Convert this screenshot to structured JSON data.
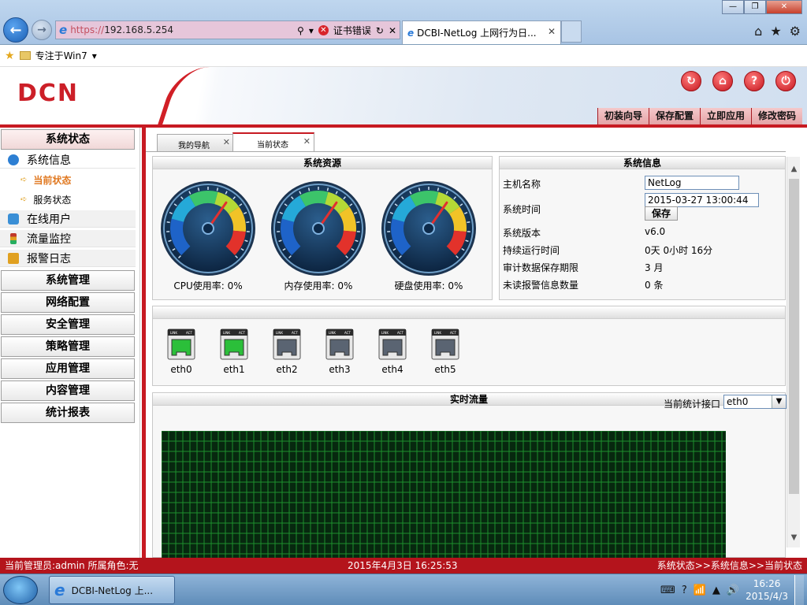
{
  "browser": {
    "address": {
      "proto": "https://",
      "host": "192.168.5.254",
      "cert_error": "证书错误"
    },
    "tab_title": "DCBI-NetLog 上网行为日...",
    "favorites": {
      "item": "专注于Win7"
    }
  },
  "app": {
    "logo": "DCN",
    "header_menu": [
      "初装向导",
      "保存配置",
      "立即应用",
      "修改密码"
    ],
    "header_icons": [
      "refresh-icon",
      "home-icon",
      "help-icon",
      "logout-icon"
    ]
  },
  "sidebar": {
    "sections": [
      "系统状态",
      "系统管理",
      "网络配置",
      "安全管理",
      "策略管理",
      "应用管理",
      "内容管理",
      "统计报表"
    ],
    "status_items": [
      {
        "label": "系统信息",
        "icon": "info-icon",
        "color": "#2d7fd3"
      },
      {
        "label": "在线用户",
        "icon": "users-icon",
        "color": "#3a8fd6"
      },
      {
        "label": "流量监控",
        "icon": "traffic-light-icon",
        "color": "#c0392b"
      },
      {
        "label": "报警日志",
        "icon": "alarm-icon",
        "color": "#e0a020"
      }
    ],
    "sub_items": [
      {
        "label": "当前状态",
        "active": true
      },
      {
        "label": "服务状态",
        "active": false
      }
    ]
  },
  "tabs": [
    {
      "label": "我的导航",
      "active": false
    },
    {
      "label": "当前状态",
      "active": true
    }
  ],
  "resources": {
    "title": "系统资源",
    "gauges": [
      {
        "label": "CPU使用率: 0%",
        "value": 0
      },
      {
        "label": "内存使用率: 0%",
        "value": 0
      },
      {
        "label": "硬盘使用率: 0%",
        "value": 0
      }
    ]
  },
  "sysinfo": {
    "title": "系统信息",
    "hostname_label": "主机名称",
    "hostname": "NetLog",
    "time_label": "系统时间",
    "time": "2015-03-27 13:00:44",
    "save": "保存",
    "rows": [
      {
        "k": "系统版本",
        "v": "v6.0"
      },
      {
        "k": "持续运行时间",
        "v": "0天 0小时 16分"
      },
      {
        "k": "审计数据保存期限",
        "v": "3 月"
      },
      {
        "k": "未读报警信息数量",
        "v": "0 条"
      }
    ]
  },
  "ports": [
    {
      "name": "eth0",
      "link": true
    },
    {
      "name": "eth1",
      "link": true
    },
    {
      "name": "eth2",
      "link": false
    },
    {
      "name": "eth3",
      "link": false
    },
    {
      "name": "eth4",
      "link": false
    },
    {
      "name": "eth5",
      "link": false
    }
  ],
  "port_jack": {
    "left": "LINK",
    "right": "ACT"
  },
  "flow": {
    "title": "实时流量",
    "iface_label": "当前统计接口",
    "iface": "eth0"
  },
  "statusbar": {
    "left": "当前管理员:admin  所属角色:无",
    "center": "2015年4月3日  16:25:53",
    "right": "系统状态>>系统信息>>当前状态"
  },
  "taskbar": {
    "task": "DCBI-NetLog 上...",
    "time": "16:26",
    "date": "2015/4/3"
  },
  "colors": {
    "brand_red": "#c71a22",
    "chart_bg": "#07280f",
    "chart_grid": "#1d8f2e"
  }
}
